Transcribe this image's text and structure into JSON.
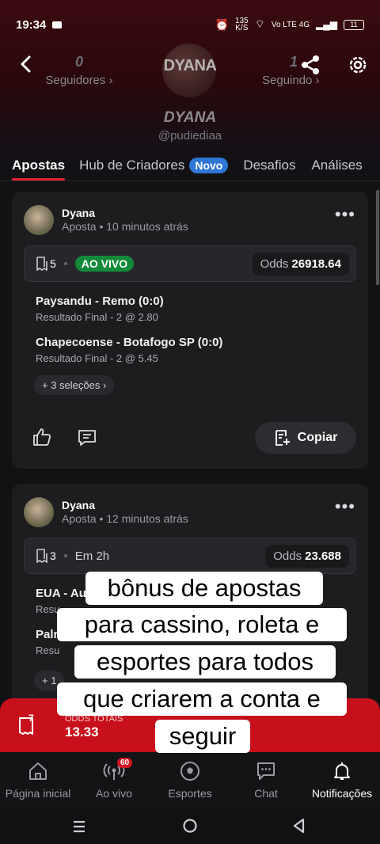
{
  "status_bar": {
    "time": "19:34",
    "speed": "135\nK/S",
    "network": "Vo LTE 4G",
    "battery": "11"
  },
  "profile": {
    "followers_count": "0",
    "followers_label": "Seguidores ›",
    "following_count": "1",
    "following_label": "Seguindo ›",
    "avatar_text": "DYANA",
    "display_name": "DYANA",
    "handle": "@pudiediaa"
  },
  "tabs": [
    {
      "label": "Apostas"
    },
    {
      "label": "Hub de Criadores",
      "badge": "Novo"
    },
    {
      "label": "Desafios"
    },
    {
      "label": "Análises"
    }
  ],
  "posts": [
    {
      "user": "Dyana",
      "meta": "Aposta • 10 minutos atrás",
      "selections_count": "5",
      "status": "AO VIVO",
      "odds_label": "Odds",
      "odds_value": "26918.64",
      "selections": [
        {
          "match": "Paysandu - Remo (0:0)",
          "pick": "Resultado Final - 2 @ 2.80"
        },
        {
          "match": "Chapecoense - Botafogo SP (0:0)",
          "pick": "Resultado Final - 2 @ 5.45"
        }
      ],
      "more": "+ 3 seleções  ›",
      "copy_label": "Copiar"
    },
    {
      "user": "Dyana",
      "meta": "Aposta • 12 minutos atrás",
      "selections_count": "3",
      "status": "Em 2h",
      "odds_label": "Odds",
      "odds_value": "23.688",
      "selections": [
        {
          "match": "EUA - Au",
          "pick": "Resu"
        },
        {
          "match": "Paln",
          "pick": "Resu"
        }
      ],
      "more": "+ 1"
    }
  ],
  "totals": {
    "label": "ODDS TOTAIS",
    "value": "13.33",
    "count": "7"
  },
  "nav": [
    {
      "label": "Página inicial"
    },
    {
      "label": "Ao vivo",
      "badge": "60"
    },
    {
      "label": "Esportes"
    },
    {
      "label": "Chat"
    },
    {
      "label": "Notificações"
    }
  ],
  "caption": {
    "lines": [
      "bônus de apostas",
      "para cassino, roleta e",
      "esportes para todos",
      "que criarem a conta e",
      "seguir"
    ]
  },
  "colors": {
    "accent_red": "#e0202c",
    "totals_red": "#c8101c",
    "live_green": "#128a3a",
    "novo_blue": "#2f77d6"
  }
}
